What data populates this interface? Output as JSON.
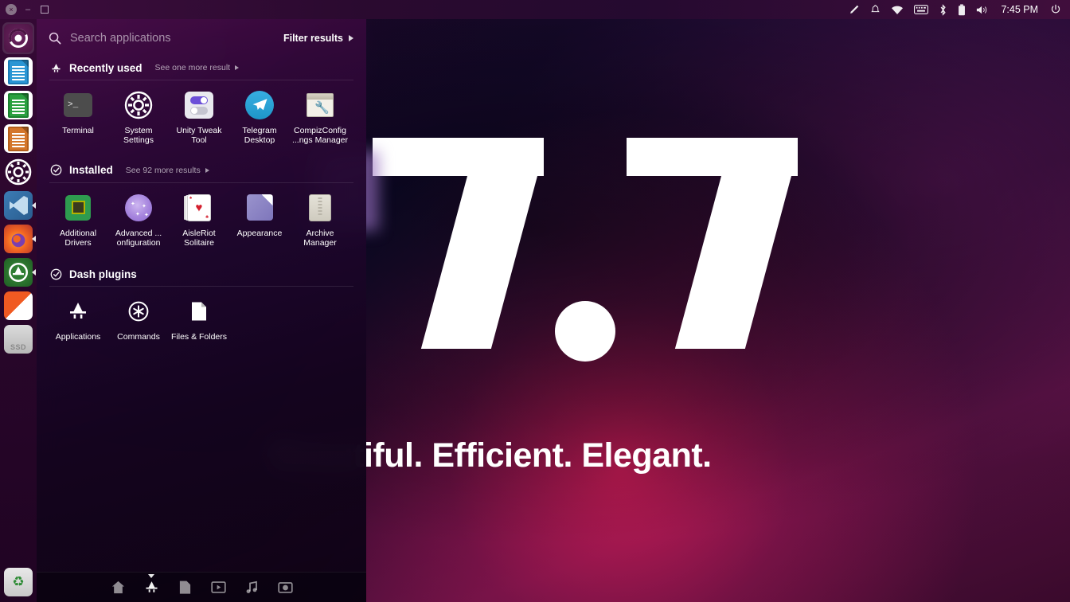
{
  "top_panel": {
    "window_controls": [
      {
        "name": "close",
        "glyph": "×"
      },
      {
        "name": "minimize",
        "glyph": "–"
      },
      {
        "name": "maximize",
        "glyph": ""
      }
    ],
    "tray": [
      {
        "name": "edit-pencil-icon",
        "glyph": "✐"
      },
      {
        "name": "notifications-bell-icon",
        "glyph": "🔔"
      },
      {
        "name": "wifi-icon",
        "glyph": "▼"
      },
      {
        "name": "keyboard-icon",
        "glyph": "⌨"
      },
      {
        "name": "bluetooth-icon",
        "glyph": "ᛩ"
      },
      {
        "name": "battery-icon",
        "glyph": "▮"
      },
      {
        "name": "volume-icon",
        "glyph": "🔊"
      }
    ],
    "clock": "7:45 PM",
    "power_glyph": "⏻"
  },
  "launcher": {
    "items": [
      {
        "name": "dash-home-bfb",
        "label": "Dash home",
        "running": false,
        "focused": true
      },
      {
        "name": "libreoffice-writer",
        "label": "LibreOffice Writer",
        "running": false
      },
      {
        "name": "libreoffice-calc",
        "label": "LibreOffice Calc",
        "running": false
      },
      {
        "name": "libreoffice-impress",
        "label": "LibreOffice Impress",
        "running": false
      },
      {
        "name": "system-settings",
        "label": "System Settings",
        "running": false
      },
      {
        "name": "visual-studio-code",
        "label": "Visual Studio Code",
        "running": true
      },
      {
        "name": "firefox",
        "label": "Firefox",
        "running": true
      },
      {
        "name": "ubuntu-software",
        "label": "Ubuntu Software",
        "running": true
      },
      {
        "name": "orange-tile-app",
        "label": "App",
        "running": false
      },
      {
        "name": "ssd-volume",
        "label": "SSD",
        "running": false
      }
    ],
    "trash": {
      "name": "trash",
      "label": "Trash",
      "glyph": "♻"
    }
  },
  "dash": {
    "search": {
      "placeholder": "Search applications",
      "value": "",
      "icon": "search-icon"
    },
    "filter_results": {
      "label": "Filter results"
    },
    "categories": [
      {
        "id": "recently-used",
        "title": "Recently used",
        "icon": "applications-lens-icon",
        "more_label": "See one more result",
        "apps": [
          {
            "name": "terminal",
            "label": "Terminal",
            "art": "terminal"
          },
          {
            "name": "system-settings",
            "label": "System Settings",
            "art": "sysset"
          },
          {
            "name": "unity-tweak-tool",
            "label": "Unity Tweak Tool",
            "art": "unitytweak"
          },
          {
            "name": "telegram-desktop",
            "label": "Telegram Desktop",
            "art": "telegram"
          },
          {
            "name": "compizconfig-settings-manager",
            "label": "CompizConfig ...ngs Manager",
            "art": "compiz"
          }
        ]
      },
      {
        "id": "installed",
        "title": "Installed",
        "icon": "check-circle-icon",
        "more_label": "See 92 more results",
        "apps": [
          {
            "name": "additional-drivers",
            "label": "Additional Drivers",
            "art": "addrivers"
          },
          {
            "name": "advanced-configuration",
            "label": "Advanced ... onfiguration",
            "art": "advconf"
          },
          {
            "name": "aisleriot-solitaire",
            "label": "AisleRiot Solitaire",
            "art": "solitaire"
          },
          {
            "name": "appearance",
            "label": "Appearance",
            "art": "appearance"
          },
          {
            "name": "archive-manager",
            "label": "Archive Manager",
            "art": "archive"
          }
        ]
      },
      {
        "id": "dash-plugins",
        "title": "Dash plugins",
        "icon": "check-circle-icon",
        "more_label": "",
        "apps": [
          {
            "name": "applications-plugin",
            "label": "Applications",
            "art": "plugin-applications"
          },
          {
            "name": "commands-plugin",
            "label": "Commands",
            "art": "plugin-commands"
          },
          {
            "name": "files-and-folders-plugin",
            "label": "Files & Folders",
            "art": "plugin-files"
          }
        ]
      }
    ],
    "lens_bar": [
      {
        "name": "lens-home",
        "glyph": "⌂",
        "active": false
      },
      {
        "name": "lens-applications",
        "glyph": "A",
        "active": true
      },
      {
        "name": "lens-files",
        "glyph": "▤",
        "active": false
      },
      {
        "name": "lens-video",
        "glyph": "▶",
        "active": false
      },
      {
        "name": "lens-music",
        "glyph": "♫",
        "active": false
      },
      {
        "name": "lens-photos",
        "glyph": "◉",
        "active": false
      }
    ]
  },
  "wallpaper": {
    "version": "7.7",
    "tagline": "Beautiful. Efficient. Elegant."
  },
  "colors": {
    "dash_tint": "#2d0632",
    "panel": "#2c0a30",
    "accent_orange": "#f05a22",
    "accent_purple": "#6b4fd8",
    "text": "#ffffff"
  }
}
